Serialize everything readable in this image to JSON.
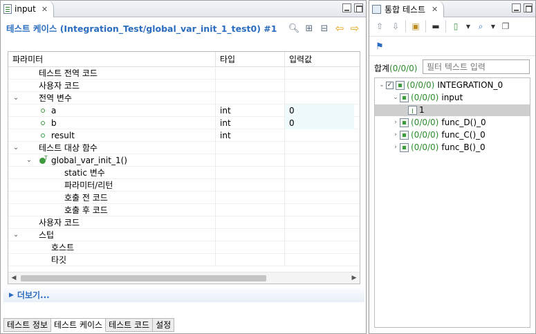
{
  "editor": {
    "tab_title": "input",
    "title": "테스트 케이스 (Integration_Test/global_var_init_1_test0) #1",
    "table": {
      "headers": [
        "파라미터",
        "타입",
        "입력값"
      ],
      "rows": [
        {
          "label": "테스트 전역 코드",
          "type": "",
          "value": ""
        },
        {
          "label": "사용자 코드",
          "type": "",
          "value": ""
        },
        {
          "label": "전역 변수",
          "type": "",
          "value": ""
        },
        {
          "label": "a",
          "type": "int",
          "value": "0"
        },
        {
          "label": "b",
          "type": "int",
          "value": "0"
        },
        {
          "label": "result",
          "type": "int",
          "value": ""
        },
        {
          "label": "테스트 대상 함수",
          "type": "",
          "value": ""
        },
        {
          "label": "global_var_init_1()",
          "type": "",
          "value": ""
        },
        {
          "label": "static 변수",
          "type": "",
          "value": ""
        },
        {
          "label": "파라미터/리턴",
          "type": "",
          "value": ""
        },
        {
          "label": "호출 전 코드",
          "type": "",
          "value": ""
        },
        {
          "label": "호출 후 코드",
          "type": "",
          "value": ""
        },
        {
          "label": "사용자 코드",
          "type": "",
          "value": ""
        },
        {
          "label": "스텁",
          "type": "",
          "value": ""
        },
        {
          "label": "호스트",
          "type": "",
          "value": ""
        },
        {
          "label": "타깃",
          "type": "",
          "value": ""
        }
      ]
    },
    "more_label": "더보기...",
    "bottom_tabs": [
      "테스트 정보",
      "테스트 케이스",
      "테스트 코드",
      "설정"
    ]
  },
  "integration": {
    "tab_title": "통합 테스트",
    "summary_label": "합계",
    "summary_count": "(0/0/0)",
    "filter_placeholder": "필터 텍스트 입력",
    "tree": [
      {
        "count": "(0/0/0)",
        "label": "INTEGRATION_0"
      },
      {
        "count": "(0/0/0)",
        "label": "input"
      },
      {
        "count": "",
        "label": "1"
      },
      {
        "count": "(0/0/0)",
        "label": "func_D()_0"
      },
      {
        "count": "(0/0/0)",
        "label": "func_C()_0"
      },
      {
        "count": "(0/0/0)",
        "label": "func_B()_0"
      }
    ]
  }
}
